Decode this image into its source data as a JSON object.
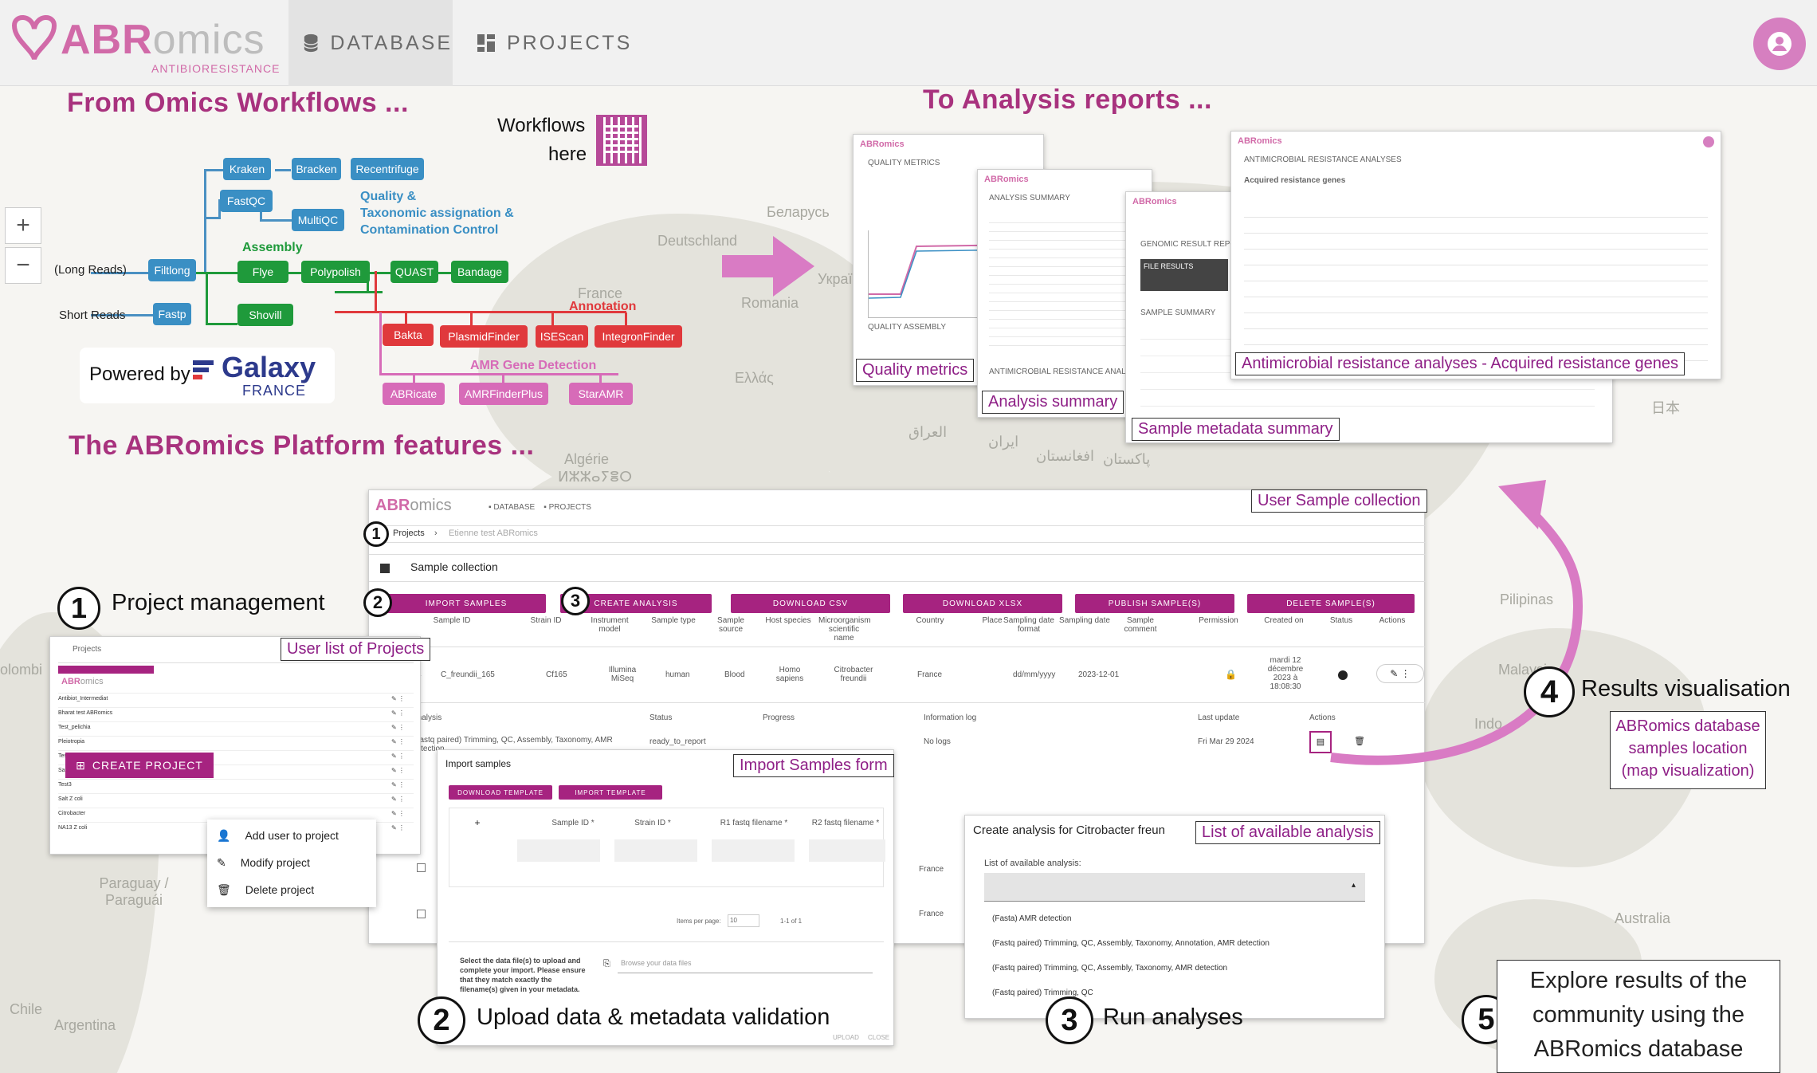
{
  "header": {
    "logo_main": "ABR",
    "logo_suffix": "omics",
    "logo_tagline": "ANTIBIORESISTANCE",
    "nav": [
      {
        "label": "DATABASE",
        "icon": "database-icon"
      },
      {
        "label": "PROJECTS",
        "icon": "grid-icon"
      }
    ],
    "avatar_icon": "user-icon"
  },
  "map": {
    "zoom_in": "+",
    "zoom_out": "−",
    "labels": [
      "Беларусь",
      "Deutschland",
      "France",
      "Україна",
      "Romania",
      "Ελλάς",
      "Algérie",
      "ⵍⵣⵣⴰⵢⴻⵔ",
      "العراق",
      "ایران",
      "افغانستان",
      "پاکستان",
      "日本",
      "Pilipinas",
      "Malaysia",
      "Indo",
      "Australia",
      "Paraguay / Paraguái",
      "Argentina",
      "Chile",
      "olombi"
    ]
  },
  "workflows": {
    "title": "From Omics Workflows ...",
    "qr_label_1": "Workflows",
    "qr_label_2": "here",
    "long_reads": "(Long Reads)",
    "short_reads": "Short Reads",
    "assembly_label": "Assembly",
    "qc_label_1": "Quality &",
    "qc_label_2": "Taxonomic assignation &",
    "qc_label_3": "Contamination Control",
    "annotation_label": "Annotation",
    "amr_label": "AMR Gene Detection",
    "powered_by": "Powered by",
    "galaxy": "Galaxy",
    "galaxy_sub": "FRANCE",
    "tools": {
      "kraken": "Kraken",
      "bracken": "Bracken",
      "recentrifuge": "Recentrifuge",
      "fastqc": "FastQC",
      "multiqc": "MultiQC",
      "filtlong": "Filtlong",
      "flye": "Flye",
      "polypolish": "Polypolish",
      "quast": "QUAST",
      "bandage": "Bandage",
      "fastp": "Fastp",
      "shovill": "Shovill",
      "bakta": "Bakta",
      "plasmidfinder": "PlasmidFinder",
      "isescan": "ISEScan",
      "integronfinder": "IntegronFinder",
      "abricate": "ABRicate",
      "amrfinderplus": "AMRFinderPlus",
      "staramr": "StarAMR"
    }
  },
  "reports": {
    "title": "To Analysis reports ...",
    "callouts": [
      "Quality metrics",
      "Analysis summary",
      "Sample metadata summary",
      "Antimicrobial resistance analyses - Acquired resistance genes"
    ],
    "card1_title": "QUALITY METRICS",
    "card1_sub": "QUALITY ASSEMBLY",
    "card2_title": "ANALYSIS SUMMARY",
    "card2_sub": "ANTIMICROBIAL RESISTANCE ANALYSES",
    "card3_title": "GENOMIC RESULT REPORT",
    "card3_box": "FILE RESULTS",
    "card3_sub": "SAMPLE SUMMARY",
    "card4_title": "ANTIMICROBIAL RESISTANCE ANALYSES",
    "card4_sub": "Acquired resistance genes"
  },
  "platform": {
    "title": "The ABRomics Platform features ...",
    "features": [
      {
        "num": "1",
        "label": "Project management"
      },
      {
        "num": "2",
        "label": "Upload data & metadata validation"
      },
      {
        "num": "3",
        "label": "Run analyses"
      },
      {
        "num": "4",
        "label": "Results visualisation"
      },
      {
        "num": "5",
        "label": "Explore results of the community using the ABRomics database"
      }
    ],
    "results_callout_1": "ABRomics database",
    "results_callout_2": "samples location",
    "results_callout_3": "(map visualization)",
    "explore_1": "Explore results of the",
    "explore_2": "community using the",
    "explore_3": "ABRomics database"
  },
  "main_screen": {
    "callout": "User Sample collection",
    "breadcrumb_root": "Projects",
    "breadcrumb_sep": "›",
    "breadcrumb_leaf": "Etienne test ABRomics",
    "section_title": "Sample collection",
    "buttons": [
      "IMPORT SAMPLES",
      "CREATE ANALYSIS",
      "DOWNLOAD CSV",
      "DOWNLOAD XLSX",
      "PUBLISH SAMPLE(S)",
      "DELETE SAMPLE(S)"
    ],
    "columns": [
      "Sample ID",
      "Strain ID",
      "Instrument model",
      "Sample type",
      "Sample source",
      "Host species",
      "Microorganism scientific name",
      "Country",
      "Place",
      "Sampling date format",
      "Sampling date",
      "Sample comment",
      "Permission",
      "Created on",
      "Status",
      "Actions"
    ],
    "row": {
      "sample_id": "C_freundii_165",
      "strain_id": "Cf165",
      "instrument": "Illumina MiSeq",
      "type": "human",
      "source": "Blood",
      "host": "Homo sapiens",
      "organism": "Citrobacter freundii",
      "country": "France",
      "date_format": "dd/mm/yyyy",
      "date": "2023-12-01",
      "created": "mardi 12 décembre 2023 à 18:08:30"
    },
    "analysis_cols": [
      "Analysis",
      "Status",
      "Progress",
      "Information log",
      "Last update",
      "Actions"
    ],
    "analysis_row": {
      "name": "(Fastq paired) Trimming, QC, Assembly, Taxonomy, AMR detection",
      "status": "ready_to_report",
      "log": "No logs",
      "updated": "Fri Mar 29 2024"
    },
    "country_rows": [
      "France",
      "France"
    ]
  },
  "projects_screen": {
    "callout": "User list of Projects",
    "crumb": "Projects",
    "create_button": "CREATE PROJECT",
    "rows": [
      "Antibiot_Intermediat",
      "Bharat test ABRomics",
      "Test_pelichia",
      "Pleiotropia",
      "Test",
      "Sample test",
      "Test3",
      "Salt Z coli",
      "Citrobacter",
      "NA13 Z coli"
    ],
    "menu": [
      "Add user to project",
      "Modify project",
      "Delete project"
    ]
  },
  "import_screen": {
    "callout": "Import Samples form",
    "title": "Import samples",
    "buttons": [
      "DOWNLOAD TEMPLATE",
      "IMPORT TEMPLATE"
    ],
    "cols": [
      "Sample ID *",
      "Strain ID *",
      "R1 fastq filename *",
      "R2 fastq filename *"
    ],
    "pager": "Items per page:",
    "pager_value": "10",
    "pager_range": "1-1 of 1",
    "instructions": "Select the data file(s) to upload and complete your import. Please ensure that they match exactly the filename(s) given in your metadata.",
    "file_placeholder": "Browse your data files",
    "footer": [
      "UPLOAD",
      "CLOSE"
    ]
  },
  "analysis_screen": {
    "callout": "List of available analysis",
    "title": "Create analysis for Citrobacter freun",
    "field_label": "List of available analysis:",
    "options": [
      "(Fasta) AMR detection",
      "(Fastq paired) Trimming, QC, Assembly, Taxonomy, Annotation, AMR detection",
      "(Fastq paired) Trimming, QC, Assembly, Taxonomy, AMR detection",
      "(Fastq paired) Trimming, QC"
    ]
  },
  "colors": {
    "accent": "#a62380",
    "pink": "#d16aa8",
    "title": "#a8327e",
    "blue": "#3a8fc4",
    "green": "#1f9a3b",
    "red": "#e0393c",
    "magenta": "#d76bb8"
  }
}
